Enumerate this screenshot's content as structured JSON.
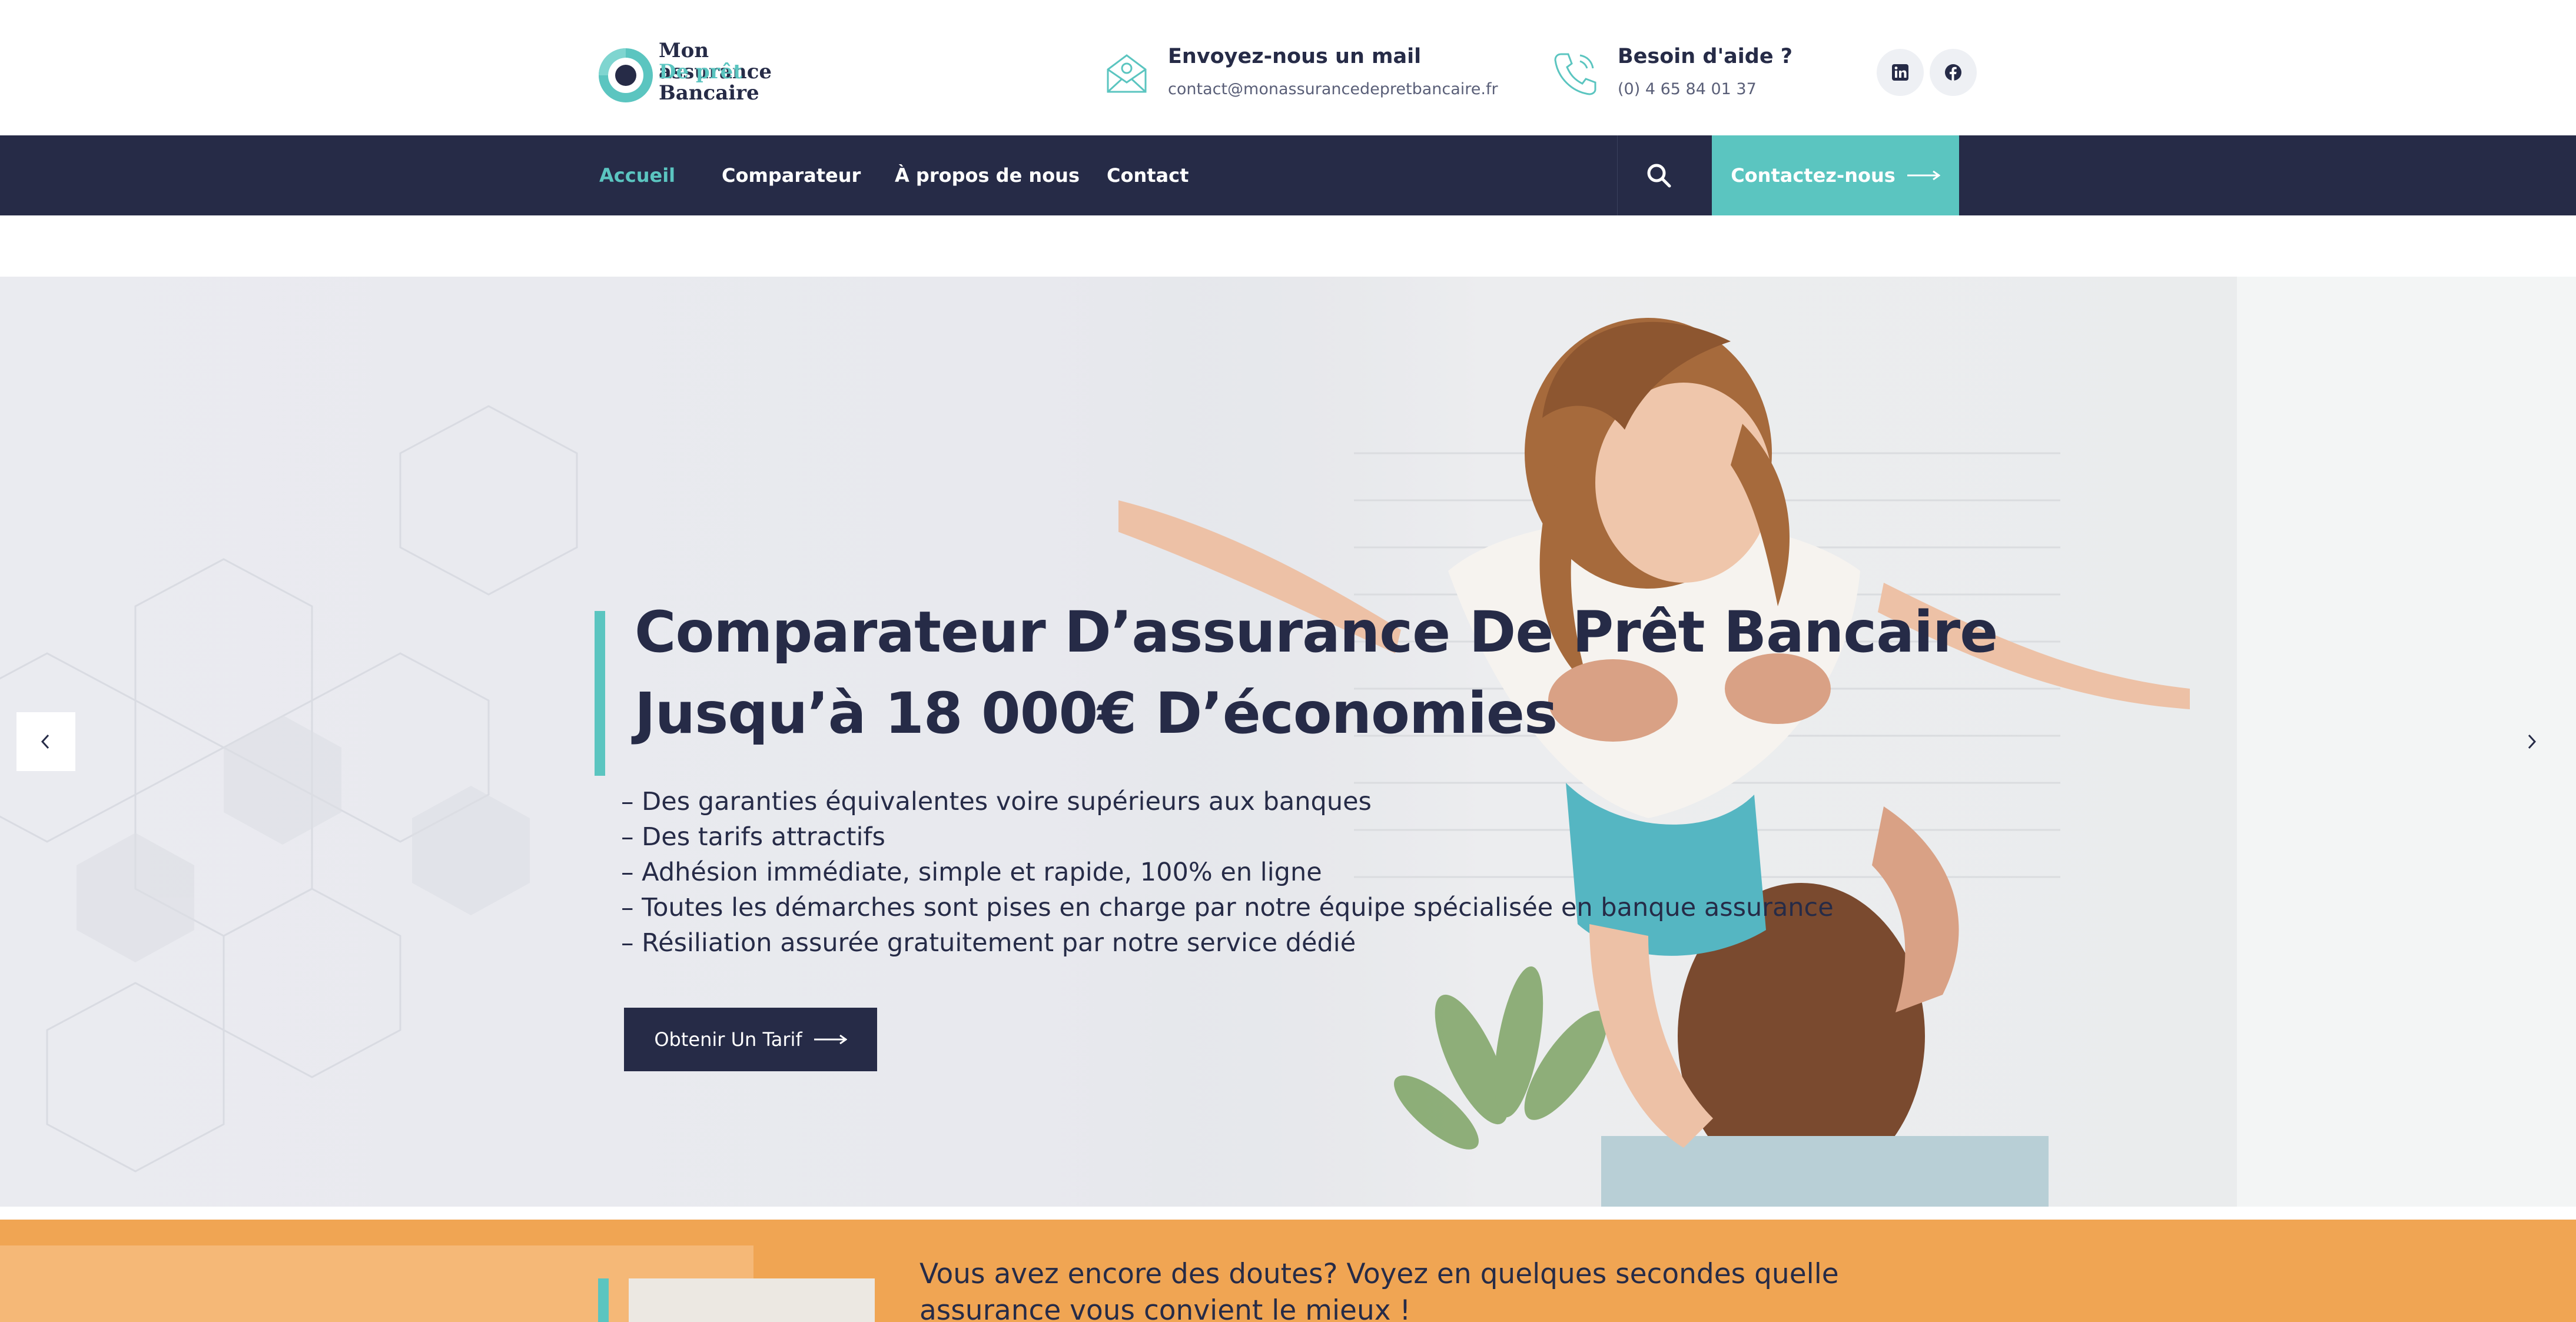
{
  "brand": {
    "line1": "Mon assurance",
    "line2": "De prêt",
    "line3": "Bancaire",
    "colors": {
      "navy": "#262b47",
      "teal": "#5bc5c0",
      "orange": "#f0a553"
    }
  },
  "header": {
    "mail": {
      "title": "Envoyez-nous un mail",
      "value": "contact@monassurancedepretbancaire.fr",
      "icon": "envelope-icon"
    },
    "phone": {
      "title": "Besoin d'aide ?",
      "value": "(0) 4 65 84 01 37",
      "icon": "phone-icon"
    },
    "social": [
      {
        "icon": "linkedin-icon"
      },
      {
        "icon": "facebook-icon"
      }
    ]
  },
  "nav": {
    "items": [
      {
        "label": "Accueil",
        "active": true
      },
      {
        "label": "Comparateur",
        "active": false
      },
      {
        "label": "À propos de nous",
        "active": false
      },
      {
        "label": "Contact",
        "active": false
      }
    ],
    "search_icon": "search-icon",
    "cta_label": "Contactez-nous"
  },
  "hero": {
    "title_line1": "Comparateur D’assurance De Prêt Bancaire",
    "title_line2": "Jusqu’à 18 000€ D’économies",
    "bullets": [
      "– Des garanties équivalentes voire supérieurs aux banques",
      "– Des tarifs attractifs",
      "– Adhésion immédiate, simple et rapide, 100% en ligne",
      "– Toutes les démarches sont pises en charge par notre équipe spécialisée en banque assurance",
      "– Résiliation assurée gratuitement par notre service dédié"
    ],
    "button_label": "Obtenir Un Tarif"
  },
  "promo": {
    "text": "Vous avez encore des doutes? Voyez en quelques secondes quelle assurance vous convient le mieux !"
  }
}
